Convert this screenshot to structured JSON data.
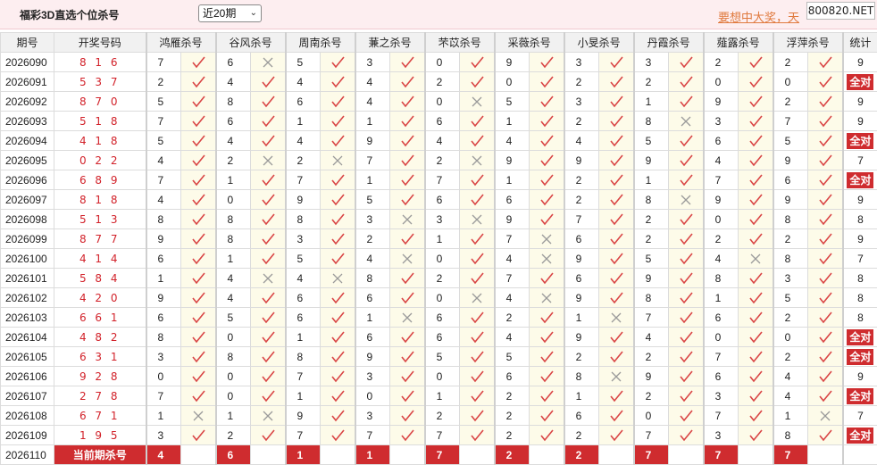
{
  "header": {
    "app_title": "福彩3D直选个位杀号",
    "period_select": "近20期",
    "promo_text": "要想中大奖，天",
    "site_badge": "800820.NET"
  },
  "columns": {
    "issue": "期号",
    "draw": "开奖号码",
    "experts": [
      "鸿雁杀号",
      "谷风杀号",
      "周南杀号",
      "蒹之杀号",
      "芣苡杀号",
      "采薇杀号",
      "小旻杀号",
      "丹霞杀号",
      "薤露杀号",
      "浮萍杀号"
    ],
    "stat": "统计"
  },
  "rows": [
    {
      "issue": "2026090",
      "draw": "8 1 6",
      "picks": [
        [
          7,
          1
        ],
        [
          6,
          0
        ],
        [
          5,
          1
        ],
        [
          3,
          1
        ],
        [
          0,
          1
        ],
        [
          9,
          1
        ],
        [
          3,
          1
        ],
        [
          3,
          1
        ],
        [
          2,
          1
        ],
        [
          2,
          1
        ]
      ],
      "stat": "9"
    },
    {
      "issue": "2026091",
      "draw": "5 3 7",
      "picks": [
        [
          2,
          1
        ],
        [
          4,
          1
        ],
        [
          4,
          1
        ],
        [
          4,
          1
        ],
        [
          2,
          1
        ],
        [
          0,
          1
        ],
        [
          2,
          1
        ],
        [
          2,
          1
        ],
        [
          0,
          1
        ],
        [
          0,
          1
        ]
      ],
      "stat": "全对"
    },
    {
      "issue": "2026092",
      "draw": "8 7 0",
      "picks": [
        [
          5,
          1
        ],
        [
          8,
          1
        ],
        [
          6,
          1
        ],
        [
          4,
          1
        ],
        [
          0,
          0
        ],
        [
          5,
          1
        ],
        [
          3,
          1
        ],
        [
          1,
          1
        ],
        [
          9,
          1
        ],
        [
          2,
          1
        ]
      ],
      "stat": "9"
    },
    {
      "issue": "2026093",
      "draw": "5 1 8",
      "picks": [
        [
          7,
          1
        ],
        [
          6,
          1
        ],
        [
          1,
          1
        ],
        [
          1,
          1
        ],
        [
          6,
          1
        ],
        [
          1,
          1
        ],
        [
          2,
          1
        ],
        [
          8,
          0
        ],
        [
          3,
          1
        ],
        [
          7,
          1
        ]
      ],
      "stat": "9"
    },
    {
      "issue": "2026094",
      "draw": "4 1 8",
      "picks": [
        [
          5,
          1
        ],
        [
          4,
          1
        ],
        [
          4,
          1
        ],
        [
          9,
          1
        ],
        [
          4,
          1
        ],
        [
          4,
          1
        ],
        [
          4,
          1
        ],
        [
          5,
          1
        ],
        [
          6,
          1
        ],
        [
          5,
          1
        ]
      ],
      "stat": "全对"
    },
    {
      "issue": "2026095",
      "draw": "0 2 2",
      "picks": [
        [
          4,
          1
        ],
        [
          2,
          0
        ],
        [
          2,
          0
        ],
        [
          7,
          1
        ],
        [
          2,
          0
        ],
        [
          9,
          1
        ],
        [
          9,
          1
        ],
        [
          9,
          1
        ],
        [
          4,
          1
        ],
        [
          9,
          1
        ]
      ],
      "stat": "7"
    },
    {
      "issue": "2026096",
      "draw": "6 8 9",
      "picks": [
        [
          7,
          1
        ],
        [
          1,
          1
        ],
        [
          7,
          1
        ],
        [
          1,
          1
        ],
        [
          7,
          1
        ],
        [
          1,
          1
        ],
        [
          2,
          1
        ],
        [
          1,
          1
        ],
        [
          7,
          1
        ],
        [
          6,
          1
        ]
      ],
      "stat": "全对"
    },
    {
      "issue": "2026097",
      "draw": "8 1 8",
      "picks": [
        [
          4,
          1
        ],
        [
          0,
          1
        ],
        [
          9,
          1
        ],
        [
          5,
          1
        ],
        [
          6,
          1
        ],
        [
          6,
          1
        ],
        [
          2,
          1
        ],
        [
          8,
          0
        ],
        [
          9,
          1
        ],
        [
          9,
          1
        ]
      ],
      "stat": "9"
    },
    {
      "issue": "2026098",
      "draw": "5 1 3",
      "picks": [
        [
          8,
          1
        ],
        [
          8,
          1
        ],
        [
          8,
          1
        ],
        [
          3,
          0
        ],
        [
          3,
          0
        ],
        [
          9,
          1
        ],
        [
          7,
          1
        ],
        [
          2,
          1
        ],
        [
          0,
          1
        ],
        [
          8,
          1
        ]
      ],
      "stat": "8"
    },
    {
      "issue": "2026099",
      "draw": "8 7 7",
      "picks": [
        [
          9,
          1
        ],
        [
          8,
          1
        ],
        [
          3,
          1
        ],
        [
          2,
          1
        ],
        [
          1,
          1
        ],
        [
          7,
          0
        ],
        [
          6,
          1
        ],
        [
          2,
          1
        ],
        [
          2,
          1
        ],
        [
          2,
          1
        ]
      ],
      "stat": "9"
    },
    {
      "issue": "2026100",
      "draw": "4 1 4",
      "picks": [
        [
          6,
          1
        ],
        [
          1,
          1
        ],
        [
          5,
          1
        ],
        [
          4,
          0
        ],
        [
          0,
          1
        ],
        [
          4,
          0
        ],
        [
          9,
          1
        ],
        [
          5,
          1
        ],
        [
          4,
          0
        ],
        [
          8,
          1
        ]
      ],
      "stat": "7"
    },
    {
      "issue": "2026101",
      "draw": "5 8 4",
      "picks": [
        [
          1,
          1
        ],
        [
          4,
          0
        ],
        [
          4,
          0
        ],
        [
          8,
          1
        ],
        [
          2,
          1
        ],
        [
          7,
          1
        ],
        [
          6,
          1
        ],
        [
          9,
          1
        ],
        [
          8,
          1
        ],
        [
          3,
          1
        ]
      ],
      "stat": "8"
    },
    {
      "issue": "2026102",
      "draw": "4 2 0",
      "picks": [
        [
          9,
          1
        ],
        [
          4,
          1
        ],
        [
          6,
          1
        ],
        [
          6,
          1
        ],
        [
          0,
          0
        ],
        [
          4,
          0
        ],
        [
          9,
          1
        ],
        [
          8,
          1
        ],
        [
          1,
          1
        ],
        [
          5,
          1
        ]
      ],
      "stat": "8"
    },
    {
      "issue": "2026103",
      "draw": "6 6 1",
      "picks": [
        [
          6,
          1
        ],
        [
          5,
          1
        ],
        [
          6,
          1
        ],
        [
          1,
          0
        ],
        [
          6,
          1
        ],
        [
          2,
          1
        ],
        [
          1,
          0
        ],
        [
          7,
          1
        ],
        [
          6,
          1
        ],
        [
          2,
          1
        ]
      ],
      "stat": "8"
    },
    {
      "issue": "2026104",
      "draw": "4 8 2",
      "picks": [
        [
          8,
          1
        ],
        [
          0,
          1
        ],
        [
          1,
          1
        ],
        [
          6,
          1
        ],
        [
          6,
          1
        ],
        [
          4,
          1
        ],
        [
          9,
          1
        ],
        [
          4,
          1
        ],
        [
          0,
          1
        ],
        [
          0,
          1
        ]
      ],
      "stat": "全对"
    },
    {
      "issue": "2026105",
      "draw": "6 3 1",
      "picks": [
        [
          3,
          1
        ],
        [
          8,
          1
        ],
        [
          8,
          1
        ],
        [
          9,
          1
        ],
        [
          5,
          1
        ],
        [
          5,
          1
        ],
        [
          2,
          1
        ],
        [
          2,
          1
        ],
        [
          7,
          1
        ],
        [
          2,
          1
        ]
      ],
      "stat": "全对"
    },
    {
      "issue": "2026106",
      "draw": "9 2 8",
      "picks": [
        [
          0,
          1
        ],
        [
          0,
          1
        ],
        [
          7,
          1
        ],
        [
          3,
          1
        ],
        [
          0,
          1
        ],
        [
          6,
          1
        ],
        [
          8,
          0
        ],
        [
          9,
          1
        ],
        [
          6,
          1
        ],
        [
          4,
          1
        ]
      ],
      "stat": "9"
    },
    {
      "issue": "2026107",
      "draw": "2 7 8",
      "picks": [
        [
          7,
          1
        ],
        [
          0,
          1
        ],
        [
          1,
          1
        ],
        [
          0,
          1
        ],
        [
          1,
          1
        ],
        [
          2,
          1
        ],
        [
          1,
          1
        ],
        [
          2,
          1
        ],
        [
          3,
          1
        ],
        [
          4,
          1
        ]
      ],
      "stat": "全对"
    },
    {
      "issue": "2026108",
      "draw": "6 7 1",
      "picks": [
        [
          1,
          0
        ],
        [
          1,
          0
        ],
        [
          9,
          1
        ],
        [
          3,
          1
        ],
        [
          2,
          1
        ],
        [
          2,
          1
        ],
        [
          6,
          1
        ],
        [
          0,
          1
        ],
        [
          7,
          1
        ],
        [
          1,
          0
        ]
      ],
      "stat": "7"
    },
    {
      "issue": "2026109",
      "draw": "1 9 5",
      "picks": [
        [
          3,
          1
        ],
        [
          2,
          1
        ],
        [
          7,
          1
        ],
        [
          7,
          1
        ],
        [
          7,
          1
        ],
        [
          2,
          1
        ],
        [
          2,
          1
        ],
        [
          7,
          1
        ],
        [
          3,
          1
        ],
        [
          8,
          1
        ]
      ],
      "stat": "全对"
    }
  ],
  "current": {
    "issue": "2026110",
    "label": "当前期杀号",
    "values": [
      4,
      6,
      1,
      1,
      7,
      2,
      2,
      7,
      7,
      7
    ]
  },
  "colors": {
    "accent_red": "#cf2c2f",
    "check_red": "#d94545",
    "cross_gray": "#9a9a9a",
    "mark_bg": "#fdfbe9",
    "header_bg": "#fdeef0"
  }
}
